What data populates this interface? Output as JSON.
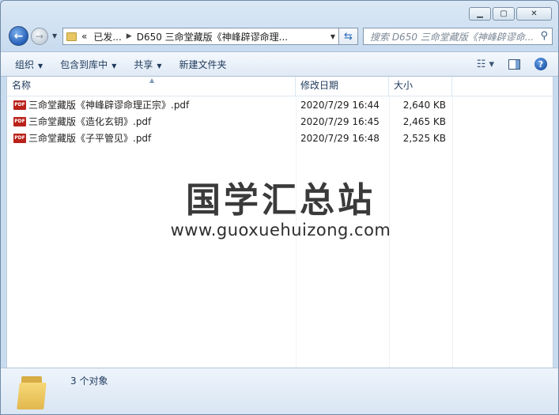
{
  "window": {
    "caption": {
      "minimize": "▁",
      "maximize": "▢",
      "close": "✕"
    }
  },
  "nav": {
    "address_prefix": "«",
    "crumb1": "已发...",
    "crumb2": "D650 三命堂藏版《神峰辟谬命理...",
    "search_placeholder": "搜索 D650 三命堂藏版《神峰辟谬命..."
  },
  "toolbar": {
    "organize": "组织",
    "include_library": "包含到库中",
    "share": "共享",
    "new_folder": "新建文件夹"
  },
  "columns": {
    "name": "名称",
    "date": "修改日期",
    "size": "大小"
  },
  "files": [
    {
      "name": "三命堂藏版《神峰辟谬命理正宗》.pdf",
      "date": "2020/7/29 16:44",
      "size": "2,640 KB"
    },
    {
      "name": "三命堂藏版《造化玄钥》.pdf",
      "date": "2020/7/29 16:45",
      "size": "2,465 KB"
    },
    {
      "name": "三命堂藏版《子平管见》.pdf",
      "date": "2020/7/29 16:48",
      "size": "2,525 KB"
    }
  ],
  "watermark": {
    "title": "国学汇总站",
    "url": "www.guoxuehuizong.com"
  },
  "status": {
    "item_count": "3 个对象"
  },
  "icons": {
    "file": "pdf-icon",
    "folder": "folder-icon"
  }
}
